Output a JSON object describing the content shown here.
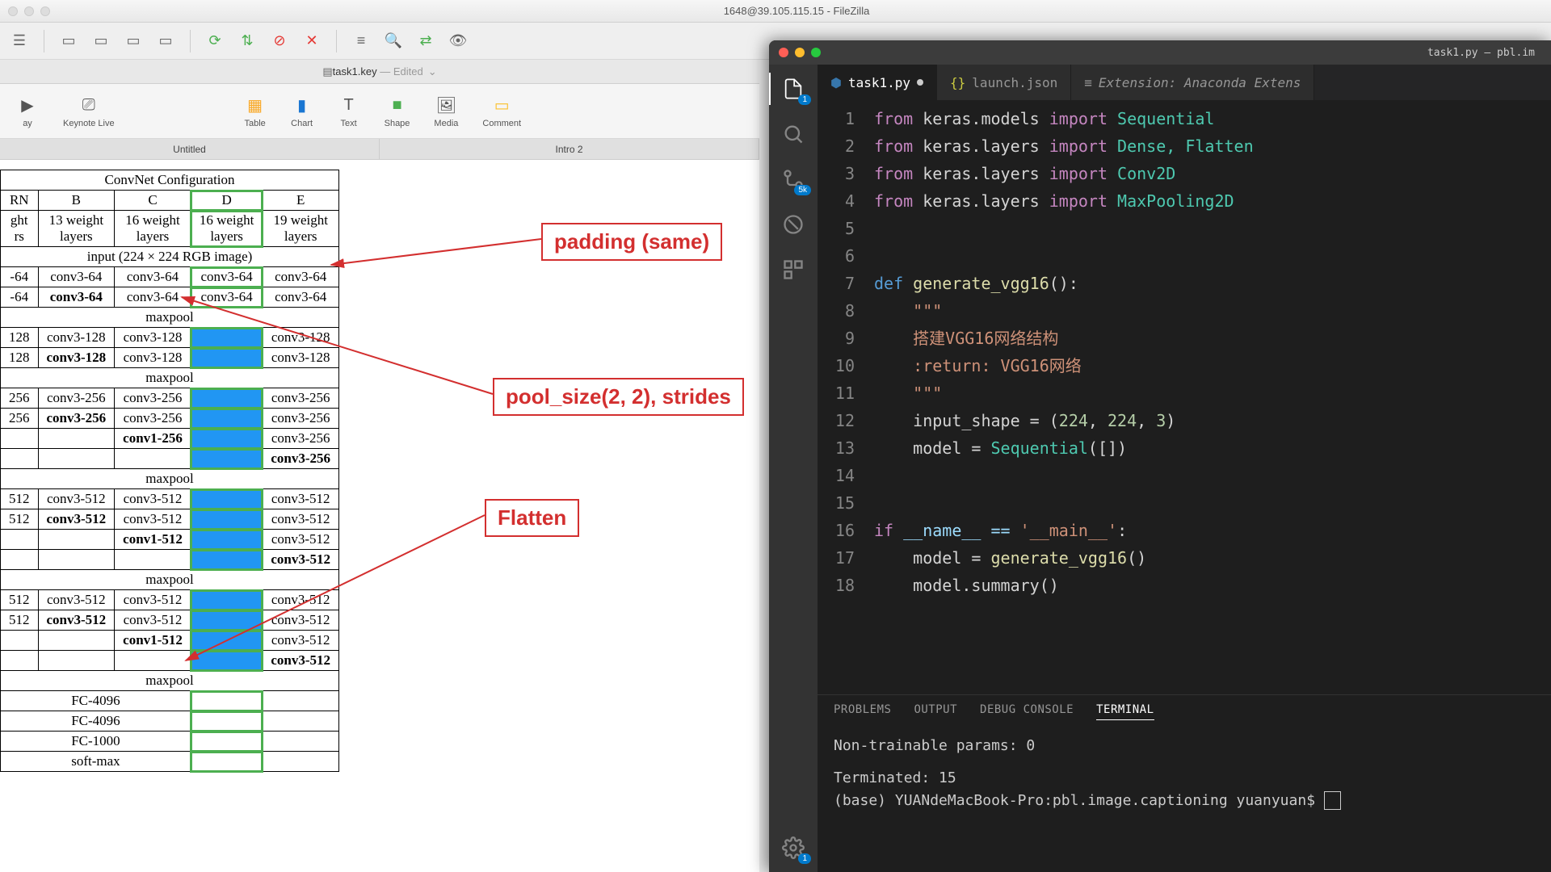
{
  "filezilla": {
    "title": "1648@39.105.115.15 - FileZilla"
  },
  "keynote": {
    "doc": "task1.key",
    "edited": "— Edited",
    "tools": {
      "live": "Keynote Live",
      "table": "Table",
      "chart": "Chart",
      "text": "Text",
      "shape": "Shape",
      "media": "Media",
      "comment": "Comment"
    },
    "tabs": {
      "t1": "Untitled",
      "t2": "Intro 2"
    }
  },
  "convnet": {
    "title": "ConvNet Configuration",
    "cols": {
      "a": "RN",
      "b": "B",
      "c": "C",
      "d": "D",
      "e": "E"
    },
    "row_weight": {
      "a": "ght\nrs",
      "b": "13 weight\nlayers",
      "c": "16 weight\nlayers",
      "d": "16 weight\nlayers",
      "e": "19 weight\nlayers"
    },
    "input": "input (224 × 224 RGB image)",
    "maxpool": "maxpool",
    "c64": "conv3-64",
    "c64b": "conv3-64",
    "c128": "conv3-128",
    "c128b": "conv3-128",
    "c256": "conv3-256",
    "c256b": "conv3-256",
    "c256_1": "conv1-256",
    "c512": "conv3-512",
    "c512b": "conv3-512",
    "c512_1": "conv1-512",
    "fc4096": "FC-4096",
    "fc1000": "FC-1000",
    "softmax": "soft-max",
    "a64": "-64",
    "a128": "128",
    "a256": "256",
    "a512": "512"
  },
  "annot": {
    "padding": "padding (same)",
    "pool": "pool_size(2, 2), strides",
    "flatten": "Flatten"
  },
  "vscode": {
    "title": "task1.py — pbl.im",
    "tabs": {
      "t1": "task1.py",
      "t2": "launch.json",
      "t3": "Extension: Anaconda Extens"
    },
    "badge_files": "1",
    "badge_scm": "5k",
    "badge_settings": "1",
    "panel": {
      "problems": "PROBLEMS",
      "output": "OUTPUT",
      "debug": "DEBUG CONSOLE",
      "terminal": "TERMINAL"
    },
    "term": {
      "l1": "Non-trainable params: 0",
      "l2": "Terminated: 15",
      "l3": "(base) YUANdeMacBook-Pro:pbl.image.captioning yuanyuan$ "
    },
    "code": {
      "l1a": "from",
      "l1b": " keras.models ",
      "l1c": "import",
      "l1d": " Sequential",
      "l2a": "from",
      "l2b": " keras.layers ",
      "l2c": "import",
      "l2d": " Dense, Flatten",
      "l3a": "from",
      "l3b": " keras.layers ",
      "l3c": "import",
      "l3d": " Conv2D",
      "l4a": "from",
      "l4b": " keras.layers ",
      "l4c": "import",
      "l4d": " MaxPooling2D",
      "l7a": "def",
      "l7b": " generate_vgg16",
      "l7c": "():",
      "l8": "    \"\"\"",
      "l9": "    搭建VGG16网络结构",
      "l10": "    :return: VGG16网络",
      "l11": "    \"\"\"",
      "l12a": "    input_shape = (",
      "l12b": "224",
      "l12c": ", ",
      "l12d": "224",
      "l12e": ", ",
      "l12f": "3",
      "l12g": ")",
      "l13a": "    model = ",
      "l13b": "Sequential",
      "l13c": "([])",
      "l16a": "if",
      "l16b": " __name__ == ",
      "l16c": "'__main__'",
      "l16d": ":",
      "l17a": "    model = ",
      "l17b": "generate_vgg16",
      "l17c": "()",
      "l18": "    model.summary()"
    },
    "ln": {
      "1": "1",
      "2": "2",
      "3": "3",
      "4": "4",
      "5": "5",
      "6": "6",
      "7": "7",
      "8": "8",
      "9": "9",
      "10": "10",
      "11": "11",
      "12": "12",
      "13": "13",
      "14": "14",
      "15": "15",
      "16": "16",
      "17": "17",
      "18": "18"
    }
  }
}
